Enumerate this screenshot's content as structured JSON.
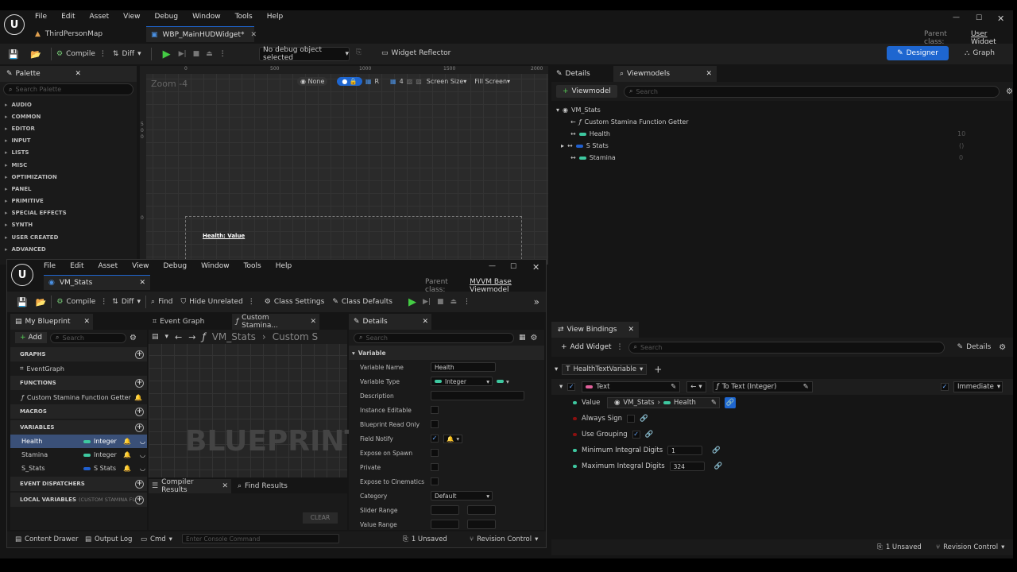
{
  "main": {
    "menu": [
      "File",
      "Edit",
      "Asset",
      "View",
      "Debug",
      "Window",
      "Tools",
      "Help"
    ],
    "tabs": [
      {
        "label": "ThirdPersonMap"
      },
      {
        "label": "WBP_MainHUDWidget*"
      }
    ],
    "parent_class_label": "Parent class:",
    "parent_class_value": "User Widget",
    "toolbar": {
      "compile": "Compile",
      "diff": "Diff",
      "debug_select": "No debug object selected",
      "widget_reflector": "Widget Reflector",
      "designer": "Designer",
      "graph": "Graph"
    },
    "palette": {
      "title": "Palette",
      "search_placeholder": "Search Palette",
      "categories": [
        "AUDIO",
        "COMMON",
        "EDITOR",
        "INPUT",
        "LISTS",
        "MISC",
        "OPTIMIZATION",
        "PANEL",
        "PRIMITIVE",
        "SPECIAL EFFECTS",
        "SYNTH",
        "USER CREATED",
        "ADVANCED"
      ]
    },
    "viewport": {
      "zoom": "Zoom -4",
      "none": "None",
      "r": "R",
      "four": "4",
      "screen_size": "Screen Size",
      "fill_screen": "Fill Screen",
      "ruler": [
        "0",
        "500",
        "1000",
        "1500",
        "2000"
      ],
      "vruler": [
        "5",
        "0",
        "0",
        "0"
      ],
      "widget_text": "Health: Value"
    },
    "details_tab": "Details",
    "viewmodels_tab": "Viewmodels",
    "viewmodel_btn": "Viewmodel",
    "vm_search": "Search",
    "vm_tree": {
      "root": "VM_Stats",
      "items": [
        {
          "label": "Custom Stamina Function Getter",
          "value": ""
        },
        {
          "label": "Health",
          "value": "10"
        },
        {
          "label": "S Stats",
          "value": "()"
        },
        {
          "label": "Stamina",
          "value": "0"
        }
      ]
    },
    "view_bindings": {
      "title": "View Bindings",
      "add_widget": "Add Widget",
      "search": "Search",
      "details": "Details",
      "widget_name": "HealthTextVariable",
      "target": "Text",
      "func": "To Text (Integer)",
      "mode": "Immediate",
      "rows": [
        {
          "label": "Value",
          "vm": "VM_Stats",
          "prop": "Health"
        },
        {
          "label": "Always Sign"
        },
        {
          "label": "Use Grouping"
        },
        {
          "label": "Minimum Integral Digits",
          "value": "1"
        },
        {
          "label": "Maximum Integral Digits",
          "value": "324"
        }
      ]
    },
    "status": {
      "unsaved": "1 Unsaved",
      "revision": "Revision Control"
    }
  },
  "bp": {
    "menu": [
      "File",
      "Edit",
      "Asset",
      "View",
      "Debug",
      "Window",
      "Tools",
      "Help"
    ],
    "tab": "VM_Stats",
    "parent_class_label": "Parent class:",
    "parent_class_value": "MVVM Base Viewmodel",
    "toolbar": {
      "compile": "Compile",
      "diff": "Diff",
      "find": "Find",
      "hide_unrelated": "Hide Unrelated",
      "class_settings": "Class Settings",
      "class_defaults": "Class Defaults"
    },
    "my_blueprint": {
      "title": "My Blueprint",
      "add": "Add",
      "search": "Search",
      "graphs": "GRAPHS",
      "event_graph": "EventGraph",
      "functions": "FUNCTIONS",
      "function_item": "Custom Stamina Function Getter",
      "macros": "MACROS",
      "variables": "VARIABLES",
      "vars": [
        {
          "name": "Health",
          "type": "Integer"
        },
        {
          "name": "Stamina",
          "type": "Integer"
        },
        {
          "name": "S_Stats",
          "type": "S Stats"
        }
      ],
      "dispatchers": "EVENT DISPATCHERS",
      "locals": "LOCAL VARIABLES",
      "locals_hint": "(CUSTOM STAMINA FU"
    },
    "graph_tabs": {
      "event_graph": "Event Graph",
      "custom": "Custom Stamina..."
    },
    "breadcrumb": {
      "a": "VM_Stats",
      "b": "Custom S"
    },
    "watermark": "BLUEPRINT",
    "compiler_results": "Compiler Results",
    "find_results": "Find Results",
    "clear": "CLEAR",
    "details": {
      "title": "Details",
      "search": "Search",
      "section": "Variable",
      "rows": [
        {
          "label": "Variable Name",
          "value": "Health"
        },
        {
          "label": "Variable Type",
          "value": "Integer"
        },
        {
          "label": "Description",
          "value": ""
        },
        {
          "label": "Instance Editable"
        },
        {
          "label": "Blueprint Read Only"
        },
        {
          "label": "Field Notify"
        },
        {
          "label": "Expose on Spawn"
        },
        {
          "label": "Private"
        },
        {
          "label": "Expose to Cinematics"
        },
        {
          "label": "Category",
          "value": "Default"
        },
        {
          "label": "Slider Range"
        },
        {
          "label": "Value Range"
        }
      ]
    },
    "status": {
      "content_drawer": "Content Drawer",
      "output_log": "Output Log",
      "cmd": "Cmd",
      "console": "Enter Console Command",
      "unsaved": "1 Unsaved",
      "revision": "Revision Control"
    }
  }
}
